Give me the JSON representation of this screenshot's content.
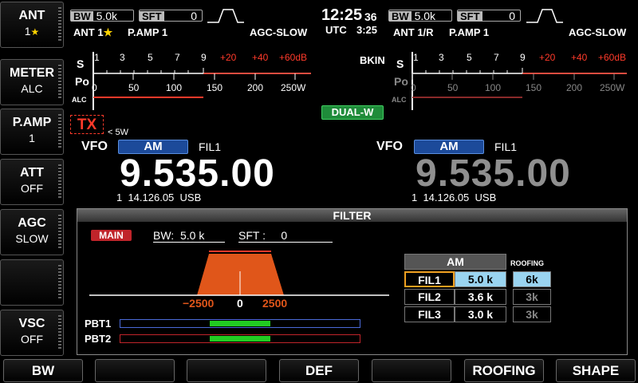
{
  "side_buttons": [
    {
      "title": "ANT",
      "value": "1",
      "star": "★"
    },
    {
      "title": "METER",
      "value": "ALC"
    },
    {
      "title": "P.AMP",
      "value": "1"
    },
    {
      "title": "ATT",
      "value": "OFF"
    },
    {
      "title": "AGC",
      "value": "SLOW"
    },
    {
      "title": "",
      "value": ""
    },
    {
      "title": "VSC",
      "value": "OFF"
    }
  ],
  "bottom_buttons": [
    "BW",
    "",
    "",
    "DEF",
    "",
    "ROOFING",
    "SHAPE"
  ],
  "clock": {
    "time": "12:25",
    "seconds": "36",
    "utc_label": "UTC",
    "utc_time": "3:25"
  },
  "main": {
    "bw_key": "BW",
    "bw_val": "5.0k",
    "sft_key": "SFT",
    "sft_val": "0",
    "ant": "ANT 1",
    "ant_star": "★",
    "pamp": "P.AMP 1",
    "agc": "AGC-SLOW",
    "vfo": "VFO",
    "mode": "AM",
    "fil": "FIL1",
    "frequency": "9.535.00",
    "memo": "1  14.126.05  USB",
    "tx": "TX",
    "power": "< 5W"
  },
  "sub": {
    "bw_key": "BW",
    "bw_val": "5.0k",
    "sft_key": "SFT",
    "sft_val": "0",
    "ant": "ANT 1/R",
    "pamp": "P.AMP 1",
    "agc": "AGC-SLOW",
    "bkin": "BKIN",
    "vfo": "VFO",
    "mode": "AM",
    "fil": "FIL1",
    "frequency": "9.535.00",
    "memo": "1  14.126.05  USB"
  },
  "dual_w": "DUAL-W",
  "meter": {
    "s_label": "S",
    "po_label": "Po",
    "alc_label": "ALC",
    "s_scale": [
      "1",
      "3",
      "5",
      "7",
      "9",
      "+20",
      "+40",
      "+60dB"
    ],
    "po_scale": [
      "0",
      "50",
      "100",
      "150",
      "200",
      "250W"
    ]
  },
  "filter": {
    "title": "FILTER",
    "main_badge": "MAIN",
    "bw_text": "BW:  5.0 k",
    "sft_text": "SFT :     0",
    "axis_left": "−2500",
    "axis_center": "0",
    "axis_right": "2500",
    "pbt1": "PBT1",
    "pbt2": "PBT2",
    "table_header": "AM",
    "rows": [
      {
        "name": "FIL1",
        "bw": "5.0 k"
      },
      {
        "name": "FIL2",
        "bw": "3.6 k"
      },
      {
        "name": "FIL3",
        "bw": "3.0 k"
      }
    ],
    "roofing_title": "ROOFING",
    "roofing": [
      "6k",
      "3k",
      "3k"
    ]
  },
  "colors": {
    "orange": "#e0561a",
    "red": "#ff3a2a",
    "blue": "#1c4a9a",
    "green": "#22cc22",
    "selected": "#9ad4f0"
  }
}
